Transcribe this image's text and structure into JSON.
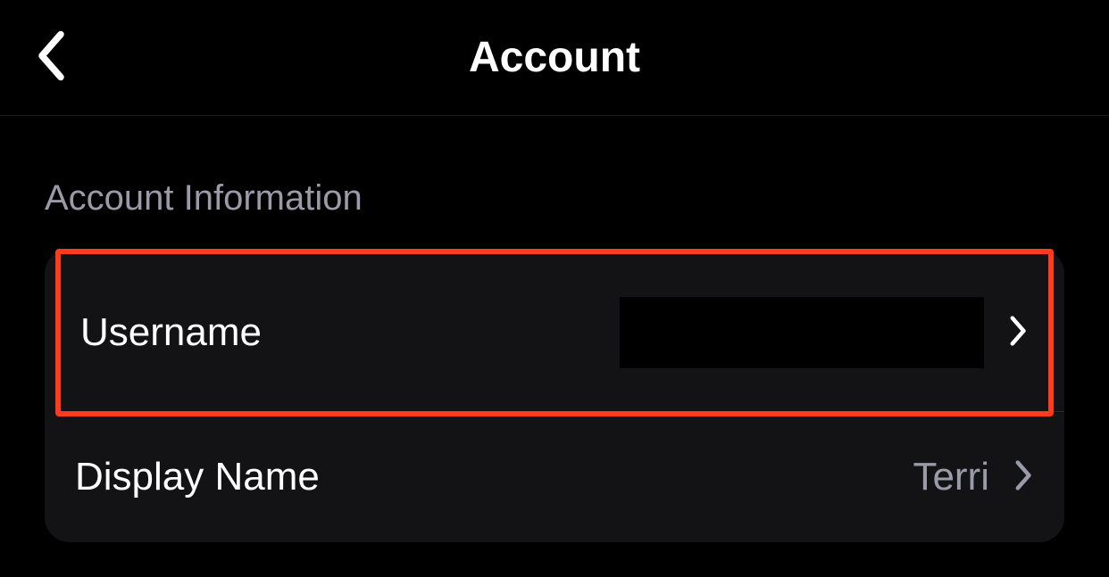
{
  "header": {
    "title": "Account"
  },
  "section": {
    "heading": "Account Information",
    "rows": [
      {
        "label": "Username",
        "value": ""
      },
      {
        "label": "Display Name",
        "value": "Terri"
      }
    ]
  }
}
